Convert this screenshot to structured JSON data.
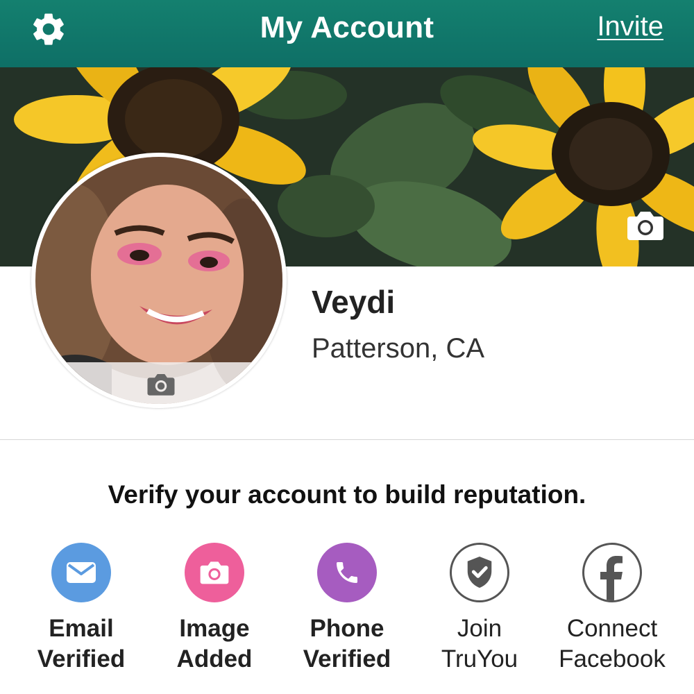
{
  "header": {
    "title": "My Account",
    "invite_label": "Invite",
    "settings_icon": "gear-icon",
    "background": "#0e7a6c"
  },
  "cover": {
    "camera_icon": "camera-icon"
  },
  "profile": {
    "name": "Veydi",
    "location": "Patterson, CA",
    "avatar_camera_icon": "camera-icon"
  },
  "verify": {
    "heading": "Verify your account to build reputation.",
    "badges": [
      {
        "line1": "Email",
        "line2": "Verified",
        "icon": "envelope-icon",
        "color": "#5b9be0",
        "done": true
      },
      {
        "line1": "Image",
        "line2": "Added",
        "icon": "camera-icon",
        "color": "#ee5f9b",
        "done": true
      },
      {
        "line1": "Phone",
        "line2": "Verified",
        "icon": "phone-icon",
        "color": "#a65cc0",
        "done": true
      },
      {
        "line1": "Join",
        "line2": "TruYou",
        "icon": "shield-check-icon",
        "color": "#555555",
        "done": false
      },
      {
        "line1": "Connect",
        "line2": "Facebook",
        "icon": "facebook-icon",
        "color": "#555555",
        "done": false
      }
    ]
  }
}
